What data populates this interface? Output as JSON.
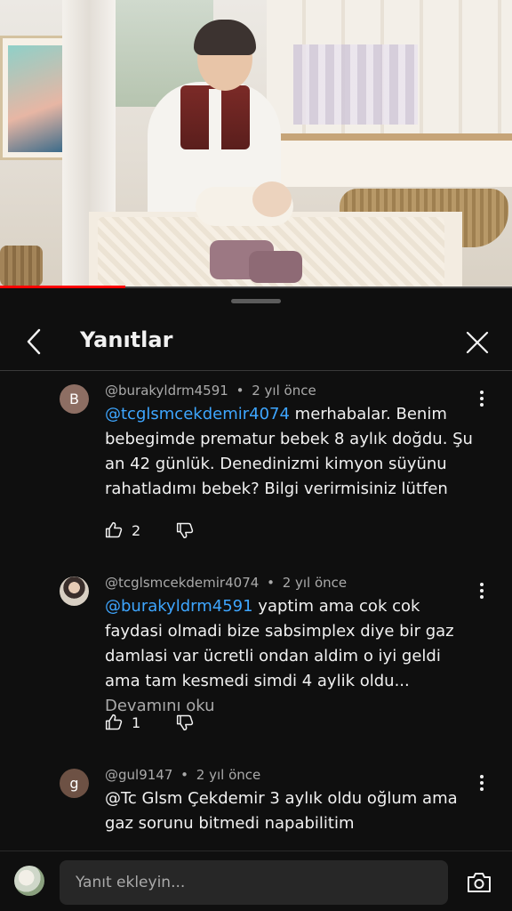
{
  "video": {
    "progress_fraction": 0.245
  },
  "sheet": {
    "title": "Yanıtlar",
    "icons": {
      "back": "chevron-left-icon",
      "close": "close-icon"
    }
  },
  "replies": [
    {
      "avatar_letter": "B",
      "avatar_color": "#8d6e63",
      "author": "@burakyldrm4591",
      "separator": "•",
      "time": "2 yıl önce",
      "mention": "@tcglsmcekdemir4074",
      "text": "merhabalar. Benim bebegimde prematur bebek 8 aylık doğdu. Şu an 42 günlük. Denedinizmi kimyon süyünu rahatladımı bebek? Bilgi verirmisiniz lütfen",
      "likes": "2"
    },
    {
      "avatar_letter": "",
      "author": "@tcglsmcekdemir4074",
      "separator": "•",
      "time": "2 yıl önce",
      "mention": "@burakyldrm4591",
      "text": "yaptim ama cok cok faydasi olmadi bize sabsimplex diye bir gaz damlasi var ücretli ondan aldim o iyi geldi ama tam kesmedi simdi 4 aylik oldu...",
      "more_label": "Devamını oku",
      "likes": "1"
    },
    {
      "avatar_letter": "g",
      "avatar_color": "#6d5144",
      "author": "@gul9147",
      "separator": "•",
      "time": "2 yıl önce",
      "text": "@Tc Glsm Çekdemir 3 aylık oldu oğlum ama gaz sorunu bitmedi napabilitim"
    }
  ],
  "composer": {
    "placeholder": "Yanıt ekleyin...",
    "camera_icon": "camera-icon"
  }
}
